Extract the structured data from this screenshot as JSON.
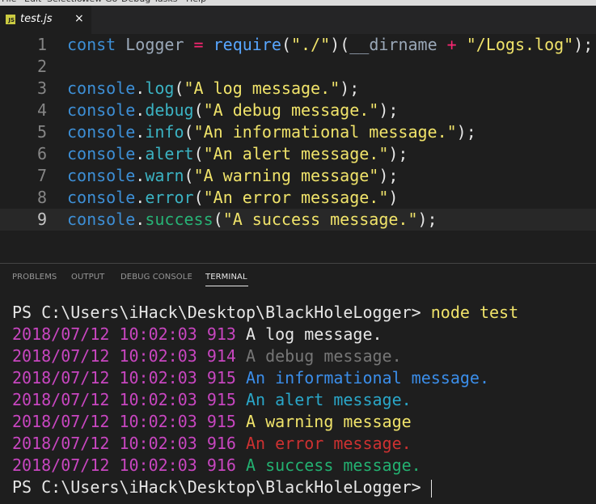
{
  "menu": {
    "items": [
      "File",
      "Edit",
      "Selection",
      "View",
      "Go",
      "Debug",
      "Tasks",
      "Help"
    ]
  },
  "editor": {
    "tab": {
      "filename": "test.js",
      "icon": "js-file-icon",
      "close_glyph": "×",
      "icon_text": "JS"
    },
    "current_line": 9,
    "lines": [
      {
        "n": "1",
        "tokens": [
          {
            "t": "const",
            "c": "c-kw"
          },
          {
            "t": " Logger ",
            "c": "c-var"
          },
          {
            "t": "=",
            "c": "c-op"
          },
          {
            "t": " ",
            "c": "c-p"
          },
          {
            "t": "require",
            "c": "c-fn"
          },
          {
            "t": "(",
            "c": "c-p"
          },
          {
            "t": "\"./\"",
            "c": "c-str"
          },
          {
            "t": ")(",
            "c": "c-p"
          },
          {
            "t": "__dirname",
            "c": "c-var"
          },
          {
            "t": " ",
            "c": "c-p"
          },
          {
            "t": "+",
            "c": "c-op"
          },
          {
            "t": " ",
            "c": "c-p"
          },
          {
            "t": "\"/Logs.log\"",
            "c": "c-str"
          },
          {
            "t": ");",
            "c": "c-p"
          }
        ]
      },
      {
        "n": "2",
        "tokens": []
      },
      {
        "n": "3",
        "tokens": [
          {
            "t": "console",
            "c": "c-obj"
          },
          {
            "t": ".",
            "c": "c-dot"
          },
          {
            "t": "log",
            "c": "c-m"
          },
          {
            "t": "(",
            "c": "c-p"
          },
          {
            "t": "\"A log message.\"",
            "c": "c-str"
          },
          {
            "t": ");",
            "c": "c-p"
          }
        ]
      },
      {
        "n": "4",
        "tokens": [
          {
            "t": "console",
            "c": "c-obj"
          },
          {
            "t": ".",
            "c": "c-dot"
          },
          {
            "t": "debug",
            "c": "c-m"
          },
          {
            "t": "(",
            "c": "c-p"
          },
          {
            "t": "\"A debug message.\"",
            "c": "c-str"
          },
          {
            "t": ");",
            "c": "c-p"
          }
        ]
      },
      {
        "n": "5",
        "tokens": [
          {
            "t": "console",
            "c": "c-obj"
          },
          {
            "t": ".",
            "c": "c-dot"
          },
          {
            "t": "info",
            "c": "c-m"
          },
          {
            "t": "(",
            "c": "c-p"
          },
          {
            "t": "\"An informational message.\"",
            "c": "c-str"
          },
          {
            "t": ");",
            "c": "c-p"
          }
        ]
      },
      {
        "n": "6",
        "tokens": [
          {
            "t": "console",
            "c": "c-obj"
          },
          {
            "t": ".",
            "c": "c-dot"
          },
          {
            "t": "alert",
            "c": "c-m"
          },
          {
            "t": "(",
            "c": "c-p"
          },
          {
            "t": "\"An alert message.\"",
            "c": "c-str"
          },
          {
            "t": ");",
            "c": "c-p"
          }
        ]
      },
      {
        "n": "7",
        "tokens": [
          {
            "t": "console",
            "c": "c-obj"
          },
          {
            "t": ".",
            "c": "c-dot"
          },
          {
            "t": "warn",
            "c": "c-m"
          },
          {
            "t": "(",
            "c": "c-p"
          },
          {
            "t": "\"A warning message\"",
            "c": "c-str"
          },
          {
            "t": ");",
            "c": "c-p"
          }
        ]
      },
      {
        "n": "8",
        "tokens": [
          {
            "t": "console",
            "c": "c-obj"
          },
          {
            "t": ".",
            "c": "c-dot"
          },
          {
            "t": "error",
            "c": "c-m"
          },
          {
            "t": "(",
            "c": "c-p"
          },
          {
            "t": "\"An error message.\"",
            "c": "c-str"
          },
          {
            "t": ")",
            "c": "c-p"
          }
        ]
      },
      {
        "n": "9",
        "tokens": [
          {
            "t": "console",
            "c": "c-obj"
          },
          {
            "t": ".",
            "c": "c-dot"
          },
          {
            "t": "success",
            "c": "c-succ"
          },
          {
            "t": "(",
            "c": "c-p"
          },
          {
            "t": "\"A success message.\"",
            "c": "c-str"
          },
          {
            "t": ");",
            "c": "c-p"
          }
        ]
      }
    ]
  },
  "panel": {
    "tabs": [
      {
        "label": "PROBLEMS",
        "active": false
      },
      {
        "label": "OUTPUT",
        "active": false
      },
      {
        "label": "DEBUG CONSOLE",
        "active": false
      },
      {
        "label": "TERMINAL",
        "active": true
      }
    ]
  },
  "terminal": {
    "prompt": "PS C:\\Users\\iHack\\Desktop\\BlackHoleLogger> ",
    "command": "node test",
    "timestamp_color": "#c846c0",
    "logs": [
      {
        "timestamp": "2018/07/12 10:02:03 913",
        "message": "A log message.",
        "color": "#e6e6e6"
      },
      {
        "timestamp": "2018/07/12 10:02:03 914",
        "message": "A debug message.",
        "color": "#767676"
      },
      {
        "timestamp": "2018/07/12 10:02:03 915",
        "message": "An informational message.",
        "color": "#3b8eea"
      },
      {
        "timestamp": "2018/07/12 10:02:03 915",
        "message": "An alert message.",
        "color": "#2aa7c9"
      },
      {
        "timestamp": "2018/07/12 10:02:03 915",
        "message": "A warning message",
        "color": "#f0e36a"
      },
      {
        "timestamp": "2018/07/12 10:02:03 916",
        "message": "An error message.",
        "color": "#cd3131"
      },
      {
        "timestamp": "2018/07/12 10:02:03 916",
        "message": "A success message.",
        "color": "#23b070"
      }
    ],
    "final_prompt": "PS C:\\Users\\iHack\\Desktop\\BlackHoleLogger>"
  }
}
